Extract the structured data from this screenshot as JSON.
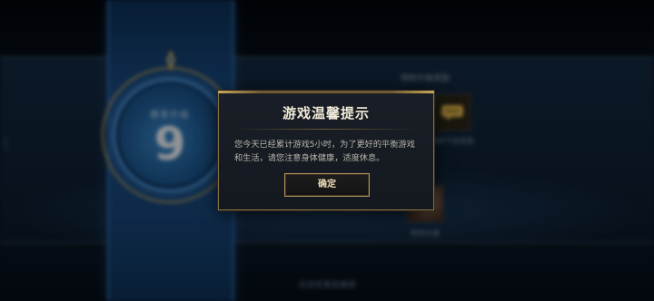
{
  "background": {
    "level_caption": "赛季升级",
    "level_number": "9",
    "section_title": "特权升级奖励",
    "reward_caption": "聊天气泡奖励",
    "portrait_caption": "特权头像",
    "bottom_caption": "点击任意处继续",
    "side_mark": "ANTI"
  },
  "dialog": {
    "title": "游戏温馨提示",
    "message": "您今天已经累计游戏5小时，为了更好的平衡游戏和生活，请您注意身体健康，适度休息。",
    "confirm_label": "确定"
  },
  "colors": {
    "dialog_border": "#8a7444",
    "button_border": "#b5955a",
    "banner_blue": "#1a4c82",
    "ring_gold": "#b79a58"
  },
  "icons": [
    "crest-icon",
    "chat-bubble-icon"
  ]
}
